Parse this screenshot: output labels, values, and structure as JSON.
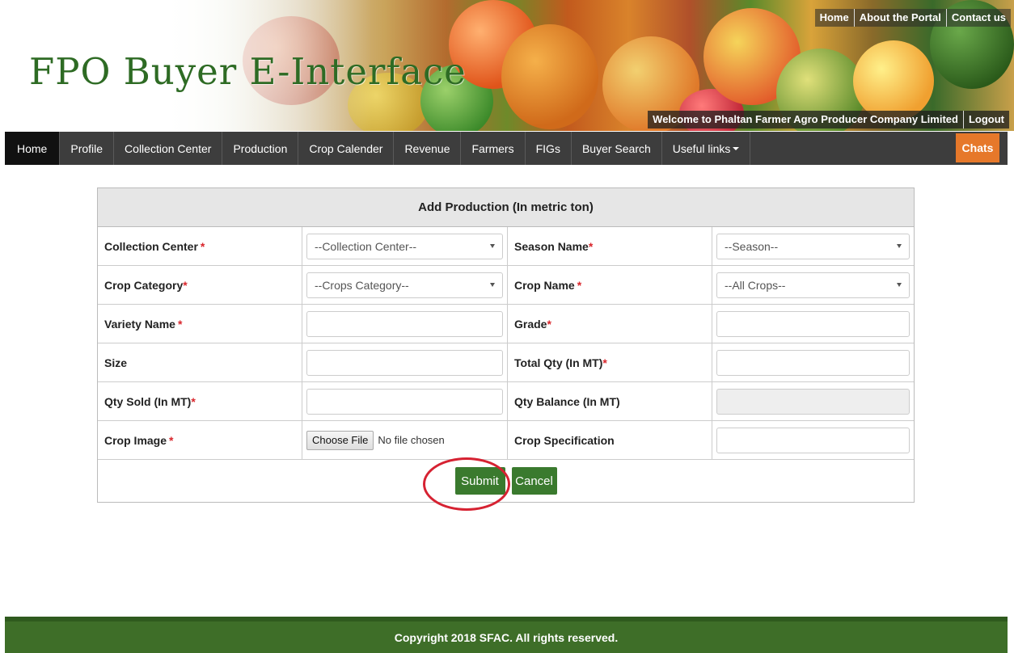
{
  "header": {
    "site_title": "FPO Buyer E-Interface",
    "top_links": [
      "Home",
      "About the Portal",
      "Contact us"
    ],
    "welcome_text": "Welcome to Phaltan Farmer Agro Producer Company Limited",
    "logout_label": "Logout"
  },
  "nav": {
    "items": [
      "Home",
      "Profile",
      "Collection Center",
      "Production",
      "Crop Calender",
      "Revenue",
      "Farmers",
      "FIGs",
      "Buyer Search",
      "Useful links"
    ],
    "active": "Home",
    "chats_label": "Chats"
  },
  "form": {
    "title": "Add Production (In metric ton)",
    "collection_center_label": "Collection Center",
    "collection_center_value": "--Collection Center--",
    "season_name_label": "Season Name",
    "season_value": "--Season--",
    "crop_category_label": "Crop Category",
    "crop_category_value": "--Crops Category--",
    "crop_name_label": "Crop Name",
    "crop_name_value": "--All Crops--",
    "variety_name_label": "Variety Name",
    "grade_label": "Grade",
    "size_label": "Size",
    "total_qty_label": "Total Qty (In MT)",
    "qty_sold_label": "Qty Sold (In MT)",
    "qty_balance_label": "Qty Balance (In MT)",
    "crop_image_label": "Crop Image",
    "choose_file_label": "Choose File",
    "no_file_text": "No file chosen",
    "crop_specification_label": "Crop Specification",
    "required_mark": "*",
    "submit_label": "Submit",
    "cancel_label": "Cancel"
  },
  "footer": {
    "copyright": "Copyright 2018 SFAC. All rights reserved."
  },
  "colors": {
    "brand_green": "#3a7a2e",
    "nav_dark": "#3d3d3d",
    "chats_orange": "#e6782a",
    "required_red": "#d9262c",
    "highlight_circle": "#d62232"
  }
}
